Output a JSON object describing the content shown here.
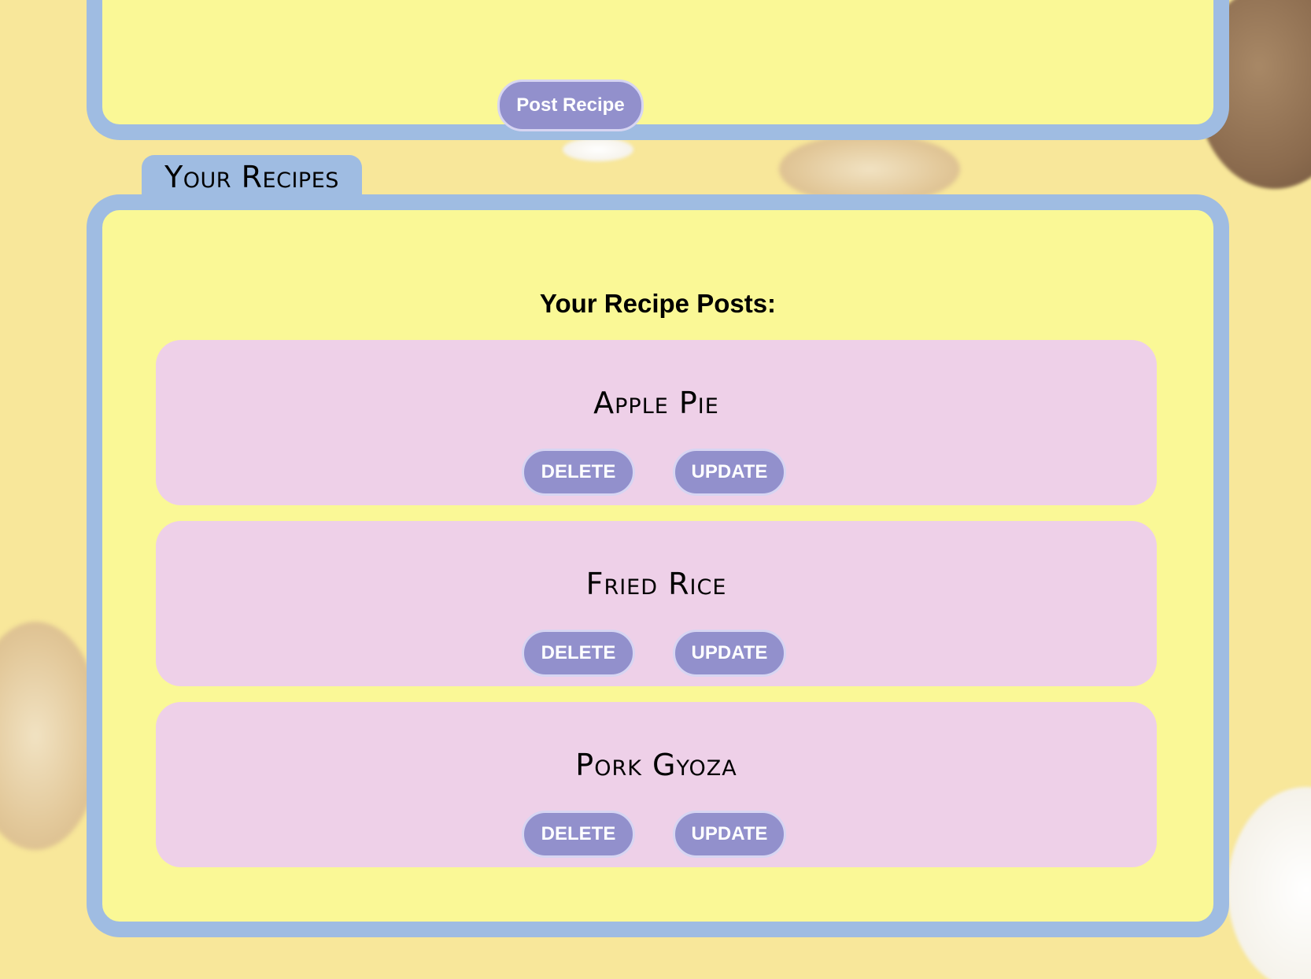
{
  "form_panel": {
    "post_button_label": "Post Recipe"
  },
  "recipes_panel": {
    "tab_label": "Your Recipes",
    "heading": "Your Recipe Posts:",
    "recipes": [
      {
        "title": "Apple Pie",
        "delete_label": "DELETE",
        "update_label": "UPDATE"
      },
      {
        "title": "Fried Rice",
        "delete_label": "DELETE",
        "update_label": "UPDATE"
      },
      {
        "title": "Pork Gyoza",
        "delete_label": "DELETE",
        "update_label": "UPDATE"
      }
    ]
  },
  "colors": {
    "page_background": "#f8e79a",
    "panel_fill": "#faf896",
    "panel_border": "#9fbce2",
    "card_fill": "#eed0e8",
    "button_fill": "#9290cc",
    "button_text": "#ffffff"
  }
}
